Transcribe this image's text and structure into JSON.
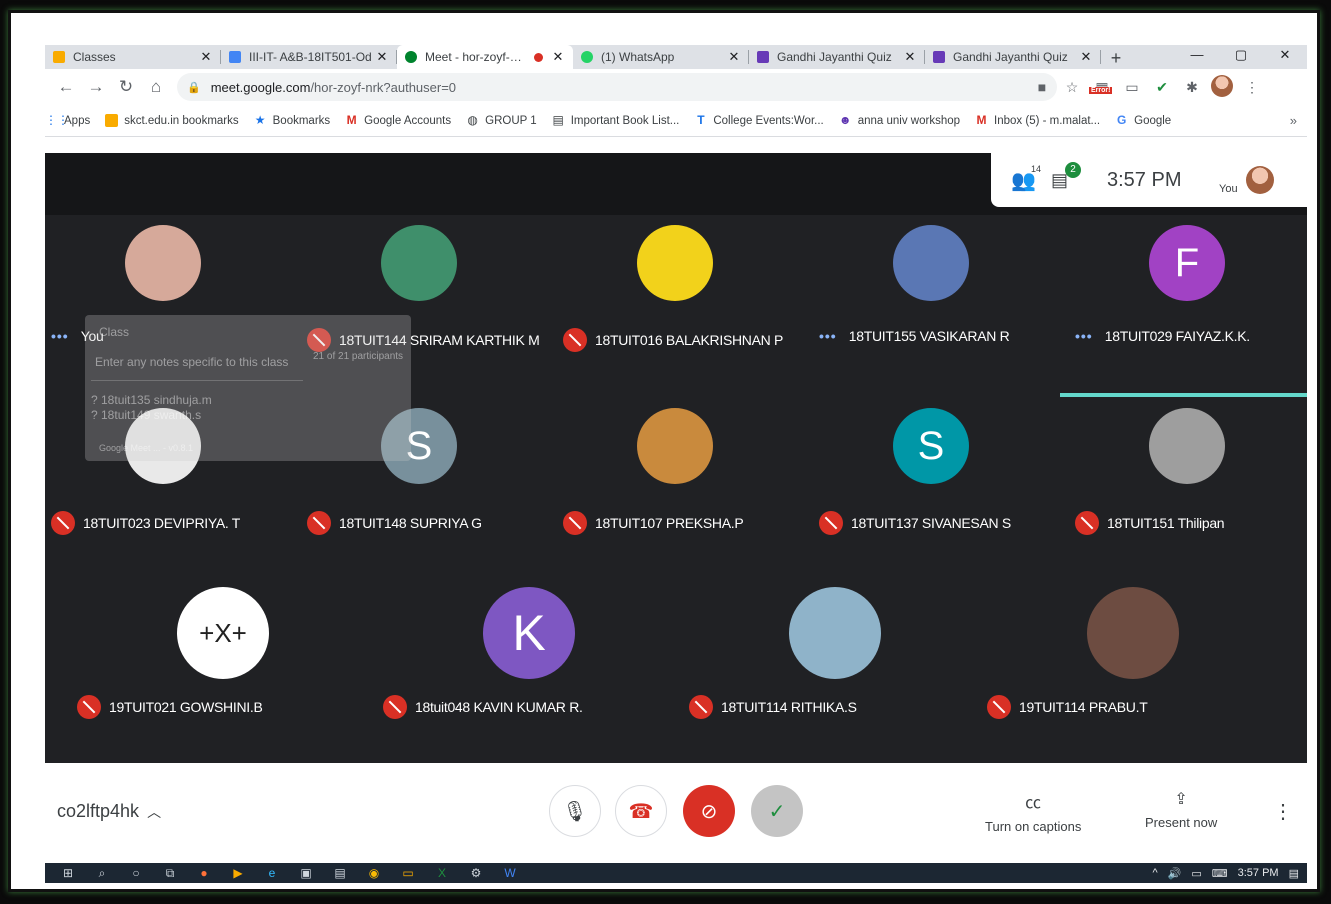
{
  "tabs": [
    {
      "title": "Classes",
      "color": "#f9ab00"
    },
    {
      "title": "III-IT- A&B-18IT501-Od",
      "color": "#4285f4"
    },
    {
      "title": "Meet - hor-zoyf-nrk",
      "color": "#00832d",
      "active": true
    },
    {
      "title": "(1) WhatsApp",
      "color": "#25d366"
    },
    {
      "title": "Gandhi Jayanthi Quiz",
      "color": "#673ab7"
    },
    {
      "title": "Gandhi Jayanthi Quiz",
      "color": "#673ab7"
    }
  ],
  "browser": {
    "url_host": "meet.google.com",
    "url_path": "/hor-zoyf-nrk?authuser=0",
    "error_badge": "Error!"
  },
  "bookmarks": [
    {
      "label": "Apps",
      "icon": "apps-grid-icon"
    },
    {
      "label": "skct.edu.in bookmarks",
      "icon": "folder-icon"
    },
    {
      "label": "Bookmarks",
      "icon": "star-icon"
    },
    {
      "label": "Google Accounts",
      "icon": "gmail-icon"
    },
    {
      "label": "GROUP 1",
      "icon": "globe-icon"
    },
    {
      "label": "Important Book List...",
      "icon": "book-icon"
    },
    {
      "label": "College Events:Wor...",
      "icon": "t-icon"
    },
    {
      "label": "anna univ workshop",
      "icon": "person-icon"
    },
    {
      "label": "Inbox (5) - m.malat...",
      "icon": "gmail-icon"
    },
    {
      "label": "Google",
      "icon": "google-icon"
    }
  ],
  "meet": {
    "participants_count": "14",
    "chat_badge": "2",
    "time": "3:57 PM",
    "self_label": "You",
    "meeting_code": "co2lftp4hk"
  },
  "notes_overlay": {
    "title": "Class",
    "placeholder": "Enter any notes specific to this class",
    "count": "21 of 21 participants",
    "lines": [
      "? 18tuit135 sindhuja.m",
      "? 18tuit149 swanth.s"
    ],
    "footer": "Google Meet ... - v0.8.1"
  },
  "participants": [
    {
      "name": "You",
      "muted": false,
      "initial": "",
      "color": "#d6a99a"
    },
    {
      "name": "18TUIT144 SRIRAM KARTHIK M",
      "muted": true,
      "initial": "",
      "color": "#3f8f6b"
    },
    {
      "name": "18TUIT016 BALAKRISHNAN P",
      "muted": true,
      "initial": "",
      "color": "#f2d21b"
    },
    {
      "name": "18TUIT155 VASIKARAN R",
      "muted": false,
      "initial": "",
      "color": "#5a77b4"
    },
    {
      "name": "18TUIT029 FAIYAZ.K.K.",
      "muted": false,
      "initial": "F",
      "color": "#a142c4"
    },
    {
      "name": "18TUIT023 DEVIPRIYA. T",
      "muted": true,
      "initial": "",
      "color": "#e9e9e9"
    },
    {
      "name": "18TUIT148 SUPRIYA G",
      "muted": true,
      "initial": "S",
      "color": "#78909c"
    },
    {
      "name": "18TUIT107 PREKSHA.P",
      "muted": true,
      "initial": "",
      "color": "#c98a3d"
    },
    {
      "name": "18TUIT137 SIVANESAN S",
      "muted": true,
      "initial": "S",
      "color": "#0097a7"
    },
    {
      "name": "18TUIT151 Thilipan",
      "muted": true,
      "initial": "",
      "color": "#9e9e9e"
    },
    {
      "name": "19TUIT021 GOWSHINI.B",
      "muted": true,
      "initial": "+X+",
      "color": "#ffffff"
    },
    {
      "name": "18tuit048 KAVIN KUMAR R.",
      "muted": true,
      "initial": "K",
      "color": "#7e57c2"
    },
    {
      "name": "18TUIT114 RITHIKA.S",
      "muted": true,
      "initial": "",
      "color": "#8fb3c9"
    },
    {
      "name": "19TUIT114 PRABU.T",
      "muted": true,
      "initial": "",
      "color": "#6d4c41"
    }
  ],
  "controls": {
    "captions_label": "Turn on captions",
    "present_label": "Present now"
  },
  "taskbar": {
    "time": "3:57 PM"
  }
}
